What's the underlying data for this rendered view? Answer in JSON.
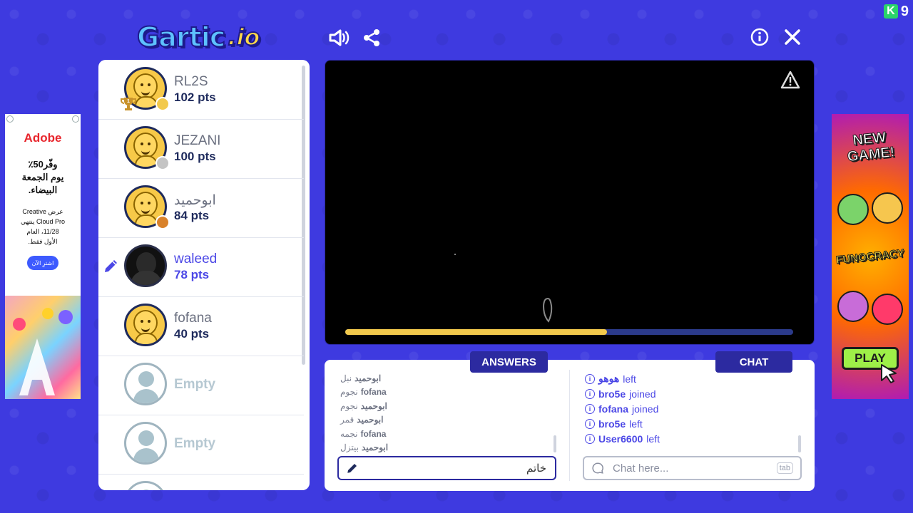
{
  "header": {
    "logo_main": "Gartic",
    "logo_suffix": ".io",
    "corner_badge_letter": "K",
    "corner_badge_value": "9"
  },
  "players": [
    {
      "name": "RL2S",
      "points": "102 pts",
      "avatar": "smiley",
      "rank_dot": "#f2c94c",
      "trophy": "1"
    },
    {
      "name": "JEZANI",
      "points": "100 pts",
      "avatar": "smiley",
      "rank_dot": "#c4c4c4"
    },
    {
      "name": "ابوحميد",
      "points": "84 pts",
      "avatar": "smiley",
      "rank_dot": "#d9822b"
    },
    {
      "name": "waleed",
      "points": "78 pts",
      "avatar": "dark-photo",
      "drawing": true
    },
    {
      "name": "fofana",
      "points": "40 pts",
      "avatar": "smiley"
    },
    {
      "empty_label": "Empty"
    },
    {
      "empty_label": "Empty"
    }
  ],
  "canvas": {
    "progress_fraction": 0.585,
    "colors": {
      "track": "#2b3a8a",
      "fill": "#f2c94c"
    }
  },
  "tabs": {
    "answers": "ANSWERS",
    "chat": "CHAT"
  },
  "answers": [
    {
      "name": "ابوحميد",
      "text": "نبل"
    },
    {
      "name": "fofana",
      "text": "نجوم"
    },
    {
      "name": "ابوحميد",
      "text": "نجوم"
    },
    {
      "name": "ابوحميد",
      "text": "قمر"
    },
    {
      "name": "fofana",
      "text": "نجمه"
    },
    {
      "name": "ابوحميد",
      "text": "بيتزل"
    }
  ],
  "answer_input": {
    "value": "خاتم"
  },
  "chat": [
    {
      "name": "هوهو",
      "text": "left"
    },
    {
      "name": "bro5e",
      "text": "joined"
    },
    {
      "name": "fofana",
      "text": "joined"
    },
    {
      "name": "bro5e",
      "text": "left"
    },
    {
      "name": "User6600",
      "text": "left"
    }
  ],
  "chat_input": {
    "placeholder": "Chat here...",
    "hint": "tab"
  },
  "ad_left": {
    "brand": "Adobe",
    "headline_1": "وفّر50٪",
    "headline_2": "يوم الجمعة",
    "headline_3": "البيضاء.",
    "small_1": "عرض Creative",
    "small_2": "Cloud Pro ينتهي",
    "small_3": "11/28، العام",
    "small_4": "الأول فقط.",
    "button": "اشترِ الآن"
  },
  "ad_right": {
    "title_1": "NEW",
    "title_2": "GAME!",
    "subtitle": "FUNOCRACY",
    "button": "PLAY"
  }
}
